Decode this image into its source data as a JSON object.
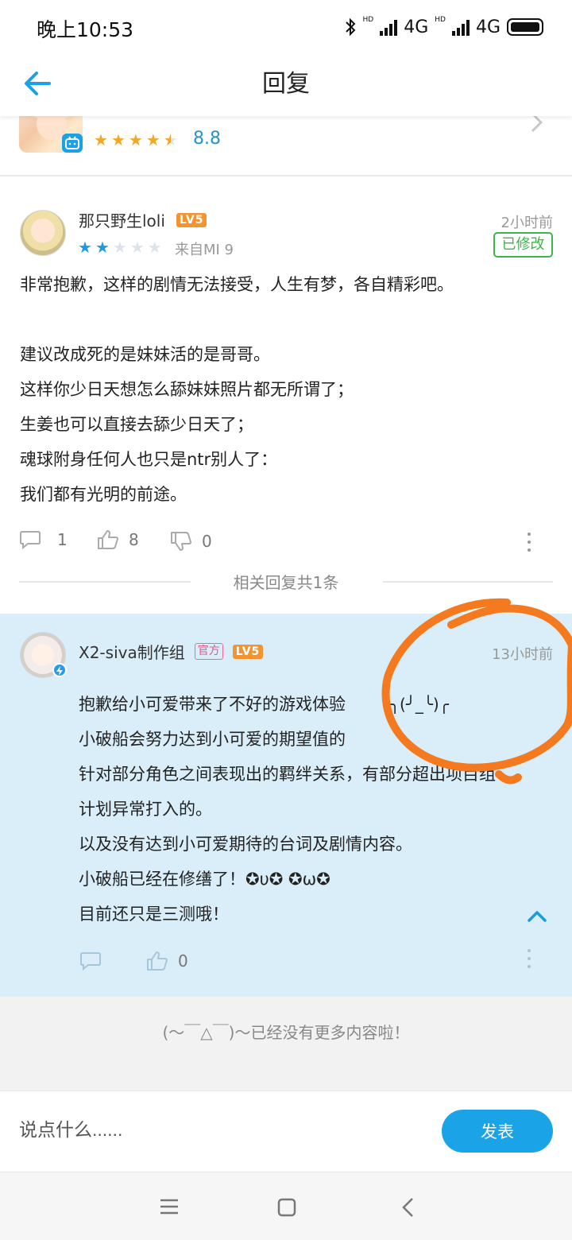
{
  "status_bar": {
    "time": "晚上10:53",
    "network1": "4G",
    "network2": "4G",
    "hd1": "HD",
    "hd2": "HD"
  },
  "header": {
    "title": "回复",
    "back_icon": "arrow-left-icon"
  },
  "game": {
    "score": "8.8",
    "rating_stars": 4.5,
    "accent": "#f5a623"
  },
  "comment": {
    "username": "那只野生loli",
    "level": "LV5",
    "time": "2小时前",
    "edited_badge": "已修改",
    "rating_stars": 2,
    "device": "来自MI 9",
    "body": [
      "非常抱歉，这样的剧情无法接受，人生有梦，各自精彩吧。",
      "",
      "建议改成死的是妹妹活的是哥哥。",
      "这样你少日天想怎么舔妹妹照片都无所谓了；",
      "生姜也可以直接去舔少日天了；",
      "魂球附身任何人也只是ntr别人了：",
      "我们都有光明的前途。"
    ],
    "reply_count": "1",
    "like_count": "8",
    "dislike_count": "0"
  },
  "related": {
    "label": "相关回复共1条"
  },
  "reply": {
    "username": "X2-siva制作组",
    "official_badge": "官方",
    "level": "LV5",
    "time": "13小时前",
    "body": [
      "抱歉给小可爱带来了不好的游戏体验",
      "小破船会努力达到小可爱的期望值的",
      "针对部分角色之间表现出的羁绊关系，有部分超出项目组",
      "计划异常打入的。",
      "以及没有达到小可爱期待的台词及剧情内容。",
      "小破船已经在修缮了！✪υ✪ ✪ω✪",
      "目前还只是三测哦！"
    ],
    "emoticon": "╮(╯_╰)╭",
    "like_count": "0",
    "background": "#d9eef9"
  },
  "footer": {
    "end_text": "(〜￣△￣)〜已经没有更多内容啦！"
  },
  "input": {
    "placeholder": "说点什么......",
    "post_label": "发表"
  },
  "colors": {
    "accent_blue": "#1aa3e6",
    "star_gold": "#f5a623",
    "star_blue": "#1e9be0",
    "edited_green": "#3cb54a",
    "annotation_orange": "#f57a1f"
  }
}
